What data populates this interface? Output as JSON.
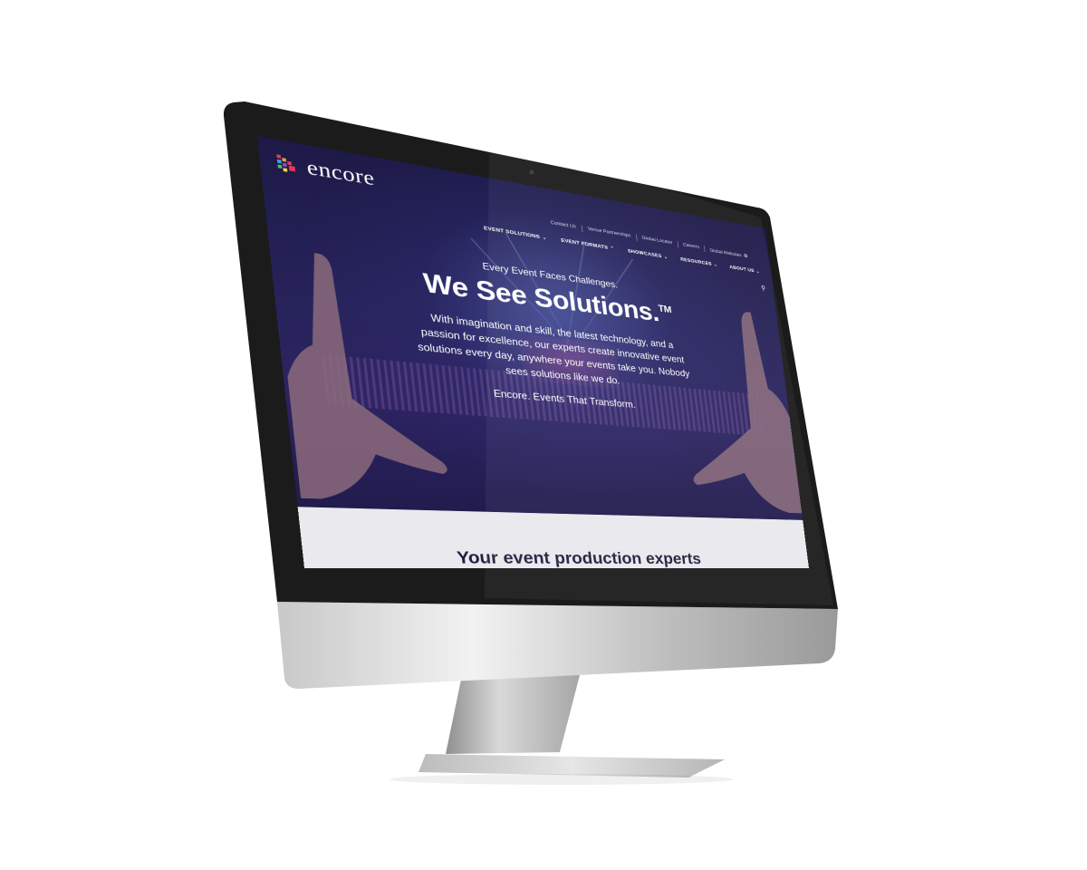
{
  "brand": {
    "name": "encore"
  },
  "utility_nav": {
    "items": [
      "Contact Us",
      "Venue Partnerships",
      "Global Locator",
      "Careers",
      "Global Websites"
    ]
  },
  "main_nav": {
    "items": [
      {
        "label": "EVENT SOLUTIONS"
      },
      {
        "label": "EVENT FORMATS"
      },
      {
        "label": "SHOWCASES"
      },
      {
        "label": "RESOURCES"
      },
      {
        "label": "ABOUT US"
      }
    ]
  },
  "hero": {
    "kicker": "Every Event Faces Challenges.",
    "headline": "We See Solutions.",
    "trademark": "TM",
    "body": "With imagination and skill, the latest technology, and a passion for excellence, our experts create innovative event solutions every day, anywhere your events take you. Nobody sees solutions like we do.",
    "tagline": "Encore. Events That Transform."
  },
  "section": {
    "title": "Your event production experts"
  },
  "icons": {
    "search": "search-icon",
    "globe": "globe-icon",
    "chevron": "chevron-down-icon"
  },
  "colors": {
    "hero_bg": "#1e1a4b",
    "section_bg": "#e9e9ee",
    "text_dark": "#1f1f3d"
  }
}
